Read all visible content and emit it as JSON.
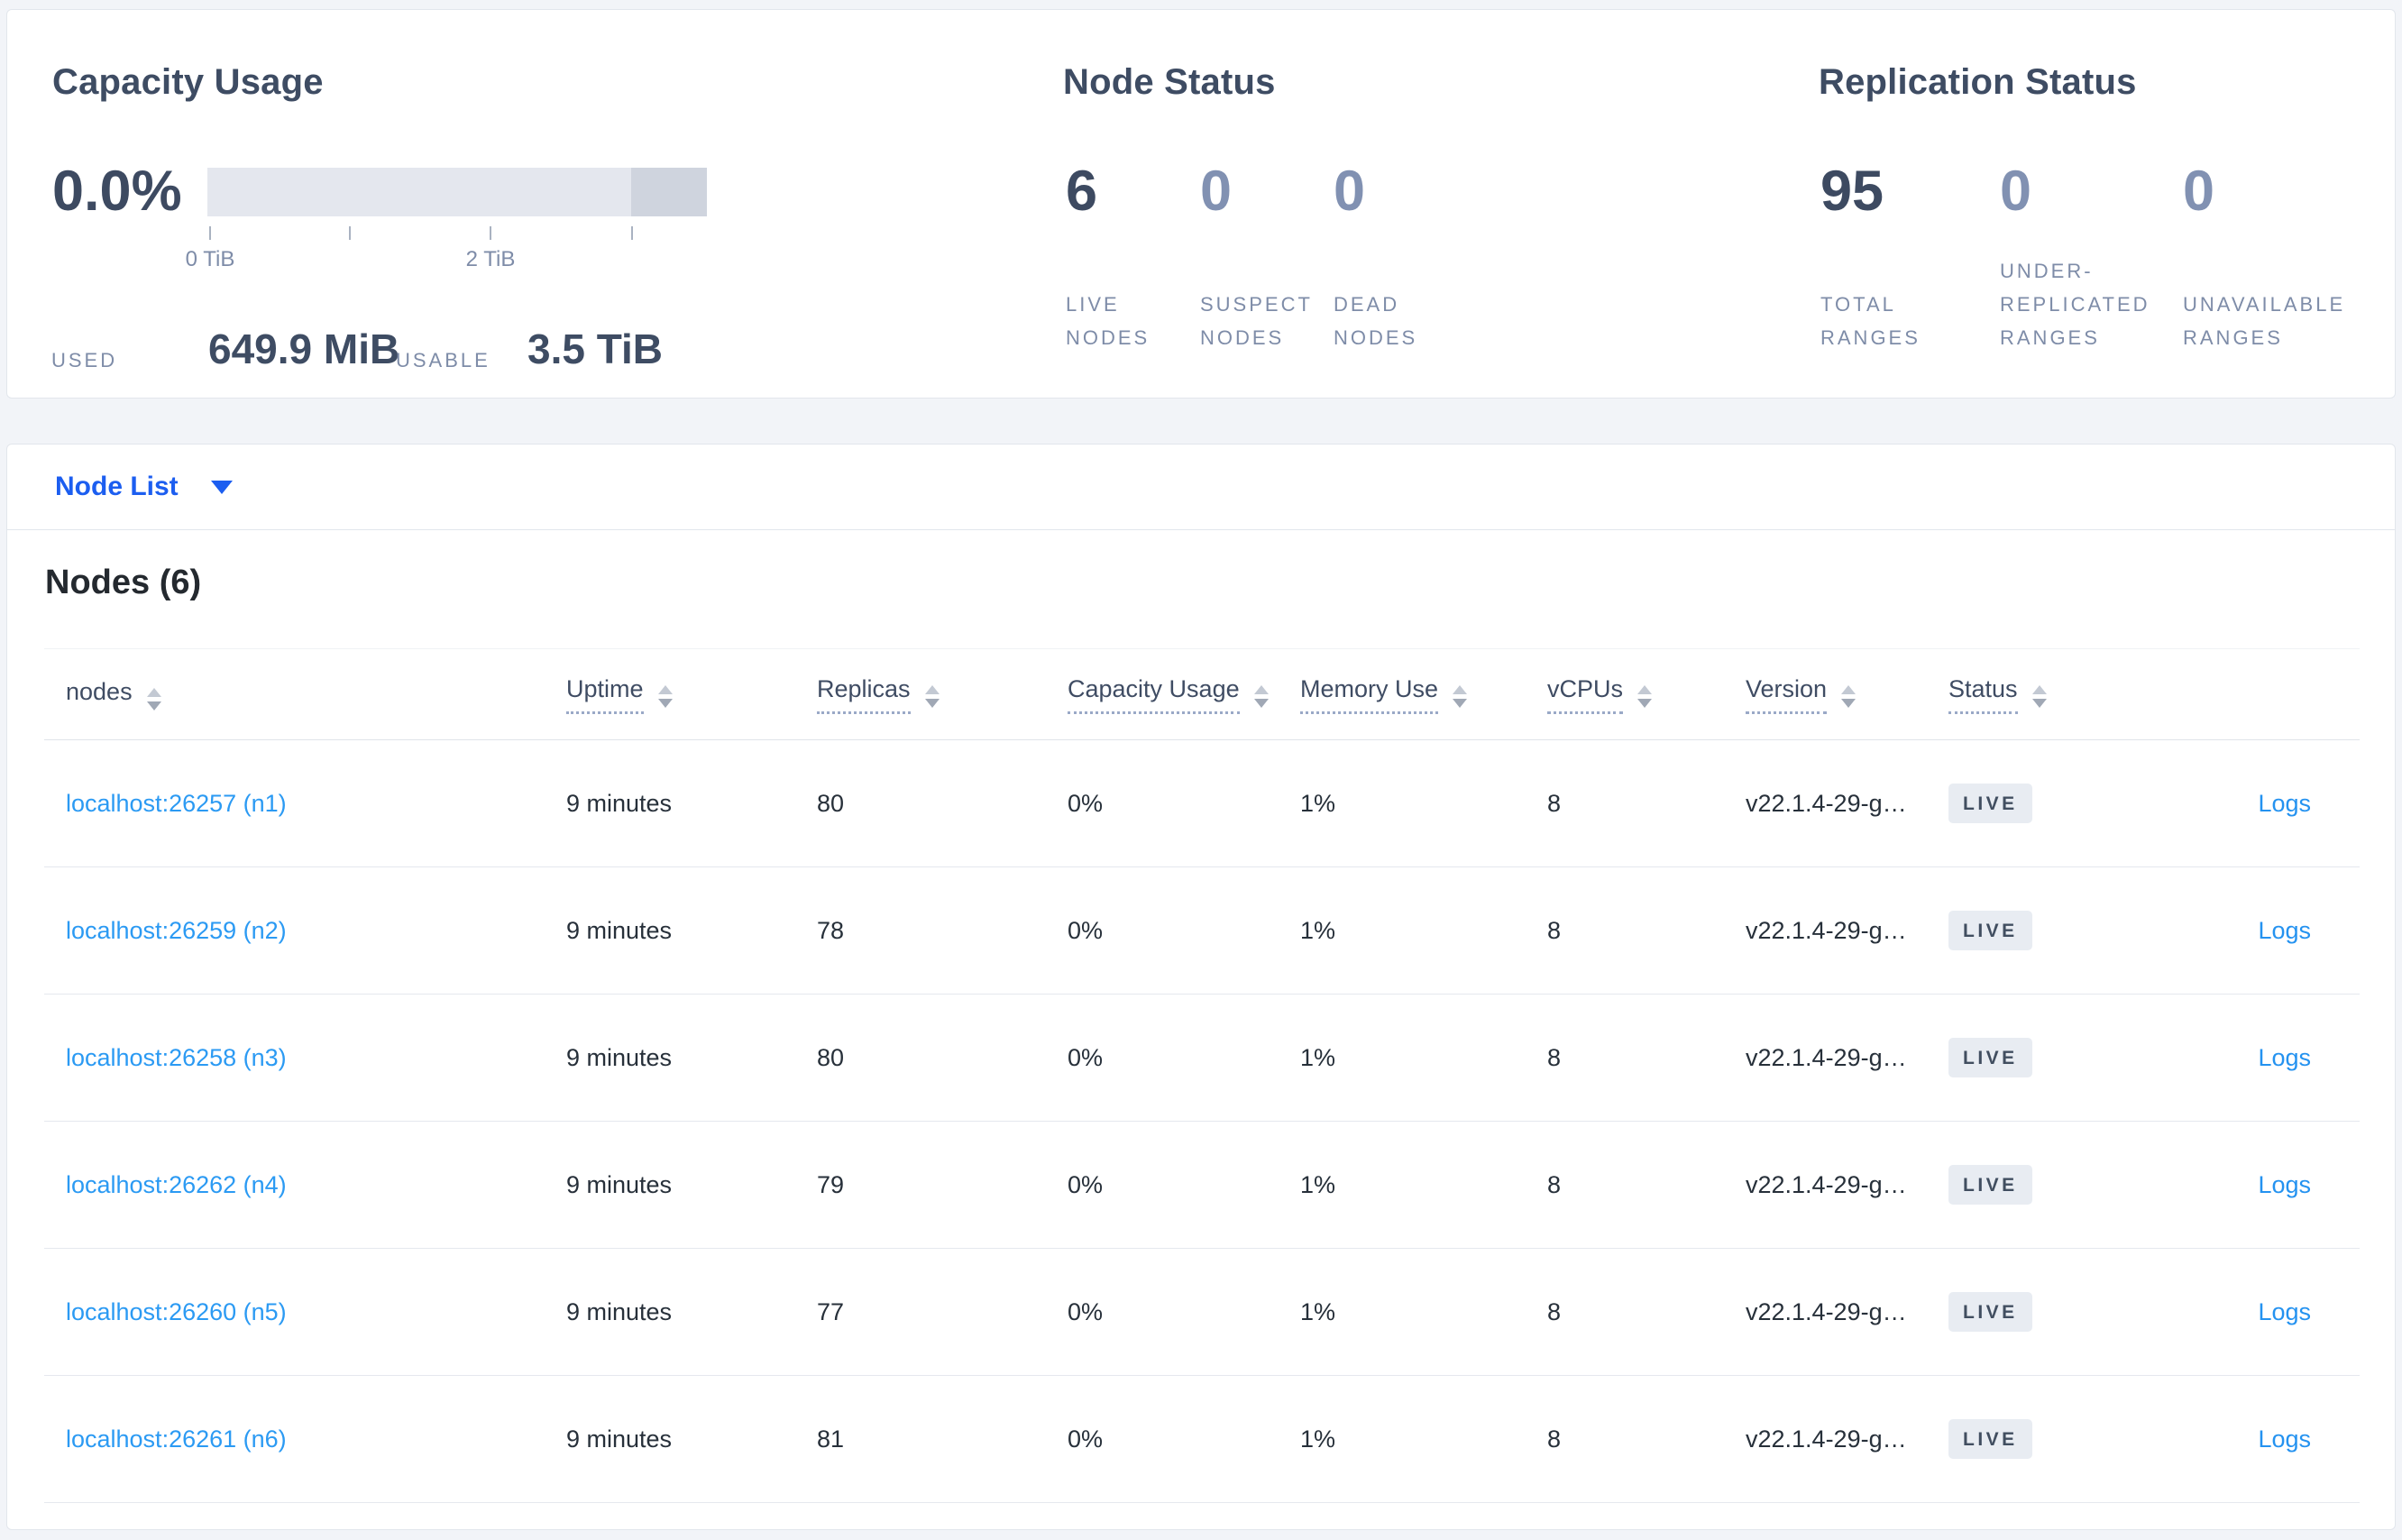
{
  "summary": {
    "capacity": {
      "title": "Capacity Usage",
      "percent": "0.0%",
      "tick_label_0": "0 TiB",
      "tick_label_2": "2 TiB",
      "used_label": "USED",
      "used_value": "649.9 MiB",
      "usable_label": "USABLE",
      "usable_value": "3.5 TiB"
    },
    "node_status": {
      "title": "Node Status",
      "stats": [
        {
          "value": "6",
          "label": "LIVE\nNODES"
        },
        {
          "value": "0",
          "label": "SUSPECT\nNODES"
        },
        {
          "value": "0",
          "label": "DEAD\nNODES"
        }
      ]
    },
    "replication_status": {
      "title": "Replication Status",
      "stats": [
        {
          "value": "95",
          "label": "TOTAL\nRANGES"
        },
        {
          "value": "0",
          "label": "UNDER-\nREPLICATED\nRANGES"
        },
        {
          "value": "0",
          "label": "UNAVAILABLE\nRANGES"
        }
      ]
    }
  },
  "node_list": {
    "label": "Node List"
  },
  "nodes": {
    "heading": "Nodes (6)",
    "columns": [
      "nodes",
      "Uptime",
      "Replicas",
      "Capacity Usage",
      "Memory Use",
      "vCPUs",
      "Version",
      "Status"
    ],
    "rows": [
      {
        "node": "localhost:26257 (n1)",
        "uptime": "9 minutes",
        "replicas": "80",
        "capacity": "0%",
        "memory": "1%",
        "vcpus": "8",
        "version": "v22.1.4-29-g…",
        "status": "LIVE",
        "logs": "Logs"
      },
      {
        "node": "localhost:26259 (n2)",
        "uptime": "9 minutes",
        "replicas": "78",
        "capacity": "0%",
        "memory": "1%",
        "vcpus": "8",
        "version": "v22.1.4-29-g…",
        "status": "LIVE",
        "logs": "Logs"
      },
      {
        "node": "localhost:26258 (n3)",
        "uptime": "9 minutes",
        "replicas": "80",
        "capacity": "0%",
        "memory": "1%",
        "vcpus": "8",
        "version": "v22.1.4-29-g…",
        "status": "LIVE",
        "logs": "Logs"
      },
      {
        "node": "localhost:26262 (n4)",
        "uptime": "9 minutes",
        "replicas": "79",
        "capacity": "0%",
        "memory": "1%",
        "vcpus": "8",
        "version": "v22.1.4-29-g…",
        "status": "LIVE",
        "logs": "Logs"
      },
      {
        "node": "localhost:26260 (n5)",
        "uptime": "9 minutes",
        "replicas": "77",
        "capacity": "0%",
        "memory": "1%",
        "vcpus": "8",
        "version": "v22.1.4-29-g…",
        "status": "LIVE",
        "logs": "Logs"
      },
      {
        "node": "localhost:26261 (n6)",
        "uptime": "9 minutes",
        "replicas": "81",
        "capacity": "0%",
        "memory": "1%",
        "vcpus": "8",
        "version": "v22.1.4-29-g…",
        "status": "LIVE",
        "logs": "Logs"
      }
    ]
  },
  "colors": {
    "accent_blue": "#1c5ef0",
    "link_blue": "#2b9af3",
    "dark_slate": "#3d4a61",
    "muted_slate": "#8191b2",
    "page_background": "#f2f4f8",
    "badge_background": "#e8ecf2"
  }
}
